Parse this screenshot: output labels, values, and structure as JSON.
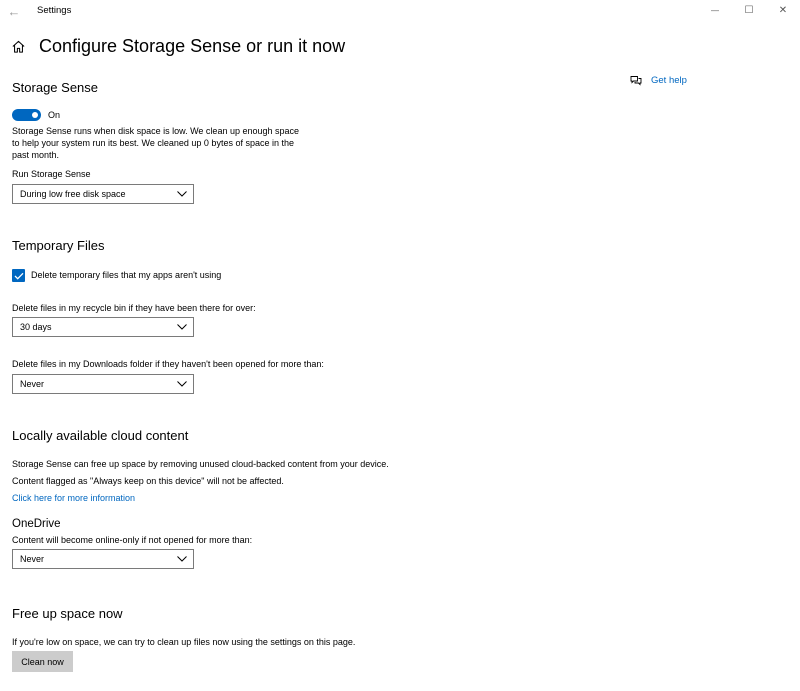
{
  "window": {
    "title": "Settings",
    "back_glyph": "←",
    "minimize_glyph": "—",
    "maximize_glyph": "☐",
    "close_glyph": "✕"
  },
  "header": {
    "title": "Configure Storage Sense or run it now",
    "get_help": "Get help"
  },
  "storage_sense": {
    "title": "Storage Sense",
    "toggle_state": "On",
    "description": "Storage Sense runs when disk space is low. We clean up enough space to help your system run its best. We cleaned up 0 bytes of space in the past month.",
    "run_label": "Run Storage Sense",
    "run_value": "During low free disk space"
  },
  "temporary_files": {
    "title": "Temporary Files",
    "delete_temp_label": "Delete temporary files that my apps aren't using",
    "delete_temp_checked": true,
    "recycle_label": "Delete files in my recycle bin if they have been there for over:",
    "recycle_value": "30 days",
    "downloads_label": "Delete files in my Downloads folder if they haven't been opened for more than:",
    "downloads_value": "Never"
  },
  "cloud_content": {
    "title": "Locally available cloud content",
    "line1": "Storage Sense can free up space by removing unused cloud-backed content from your device.",
    "line2": "Content flagged as \"Always keep on this device\" will not be affected.",
    "more_info_link": "Click here for more information",
    "onedrive_title": "OneDrive",
    "onedrive_label": "Content will become online-only if not opened for more than:",
    "onedrive_value": "Never"
  },
  "free_up": {
    "title": "Free up space now",
    "description": "If you're low on space, we can try to clean up files now using the settings on this page.",
    "button_label": "Clean now"
  },
  "icons": {
    "back": "back-arrow-icon",
    "home": "home-icon",
    "help": "chat-help-icon",
    "chevron": "chevron-down-icon",
    "check": "checkmark-icon"
  },
  "colors": {
    "accent": "#0067c0",
    "button_bg": "#cccccc",
    "border": "#7a7a7a"
  }
}
